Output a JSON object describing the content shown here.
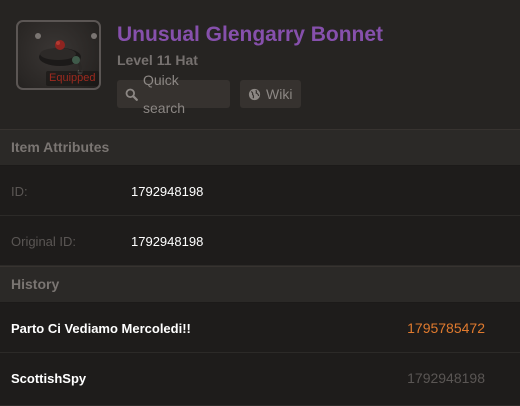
{
  "item": {
    "name": "Unusual Glengarry Bonnet",
    "level_line": "Level 11 Hat",
    "equipped_label": "Equipped",
    "icon": "glengarry-bonnet-hat-icon"
  },
  "buttons": {
    "quick_search": "Quick search",
    "wiki": "Wiki"
  },
  "attributes": {
    "heading": "Item Attributes",
    "rows": [
      {
        "label": "ID:",
        "value": "1792948198"
      },
      {
        "label": "Original ID:",
        "value": "1792948198"
      }
    ]
  },
  "history": {
    "heading": "History",
    "rows": [
      {
        "name": "Parto Ci Vediamo Mercoledi!!",
        "id": "1795785472",
        "id_color": "#e07a2e"
      },
      {
        "name": "ScottishSpy",
        "id": "1792948198",
        "id_color": "#5a5654"
      }
    ]
  },
  "colors": {
    "unusual_purple": "#8650ac",
    "equipped_red": "#9e2a1f",
    "current_id_orange": "#e07a2e"
  }
}
